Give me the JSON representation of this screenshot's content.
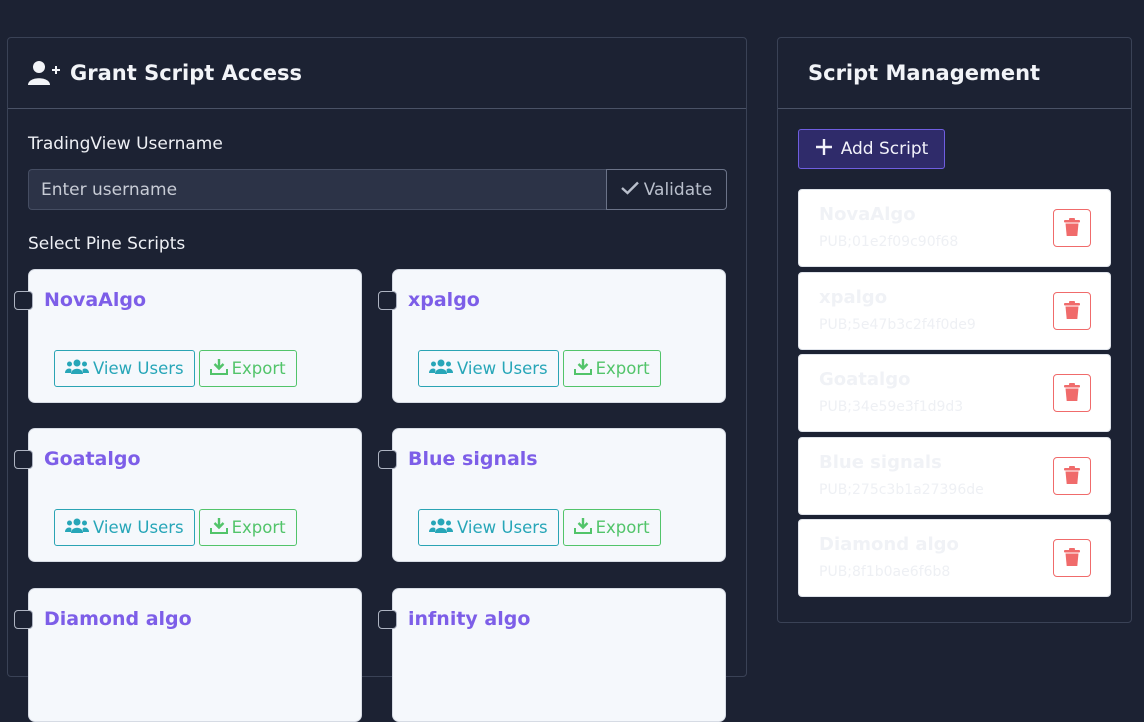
{
  "grant": {
    "title": "Grant Script Access",
    "username_label": "TradingView Username",
    "username_placeholder": "Enter username",
    "validate_label": "Validate",
    "scripts_label": "Select Pine Scripts",
    "view_users_label": "View Users",
    "export_label": "Export",
    "scripts": [
      {
        "name": "NovaAlgo"
      },
      {
        "name": "xpalgo"
      },
      {
        "name": "Goatalgo"
      },
      {
        "name": "Blue signals"
      },
      {
        "name": "Diamond algo"
      },
      {
        "name": "infnity algo"
      }
    ]
  },
  "management": {
    "title": "Script Management",
    "add_label": "Add Script",
    "items": [
      {
        "name": "NovaAlgo",
        "id": "PUB;01e2f09c90f68"
      },
      {
        "name": "xpalgo",
        "id": "PUB;5e47b3c2f4f0de9"
      },
      {
        "name": "Goatalgo",
        "id": "PUB;34e59e3f1d9d3"
      },
      {
        "name": "Blue signals",
        "id": "PUB;275c3b1a27396de"
      },
      {
        "name": "Diamond algo",
        "id": "PUB;8f1b0ae6f6b8"
      }
    ]
  },
  "colors": {
    "background": "#1c2233",
    "accent_purple": "#7d5ee8",
    "view_users": "#27a6b8",
    "export": "#52c46a",
    "delete": "#f06b6b"
  }
}
